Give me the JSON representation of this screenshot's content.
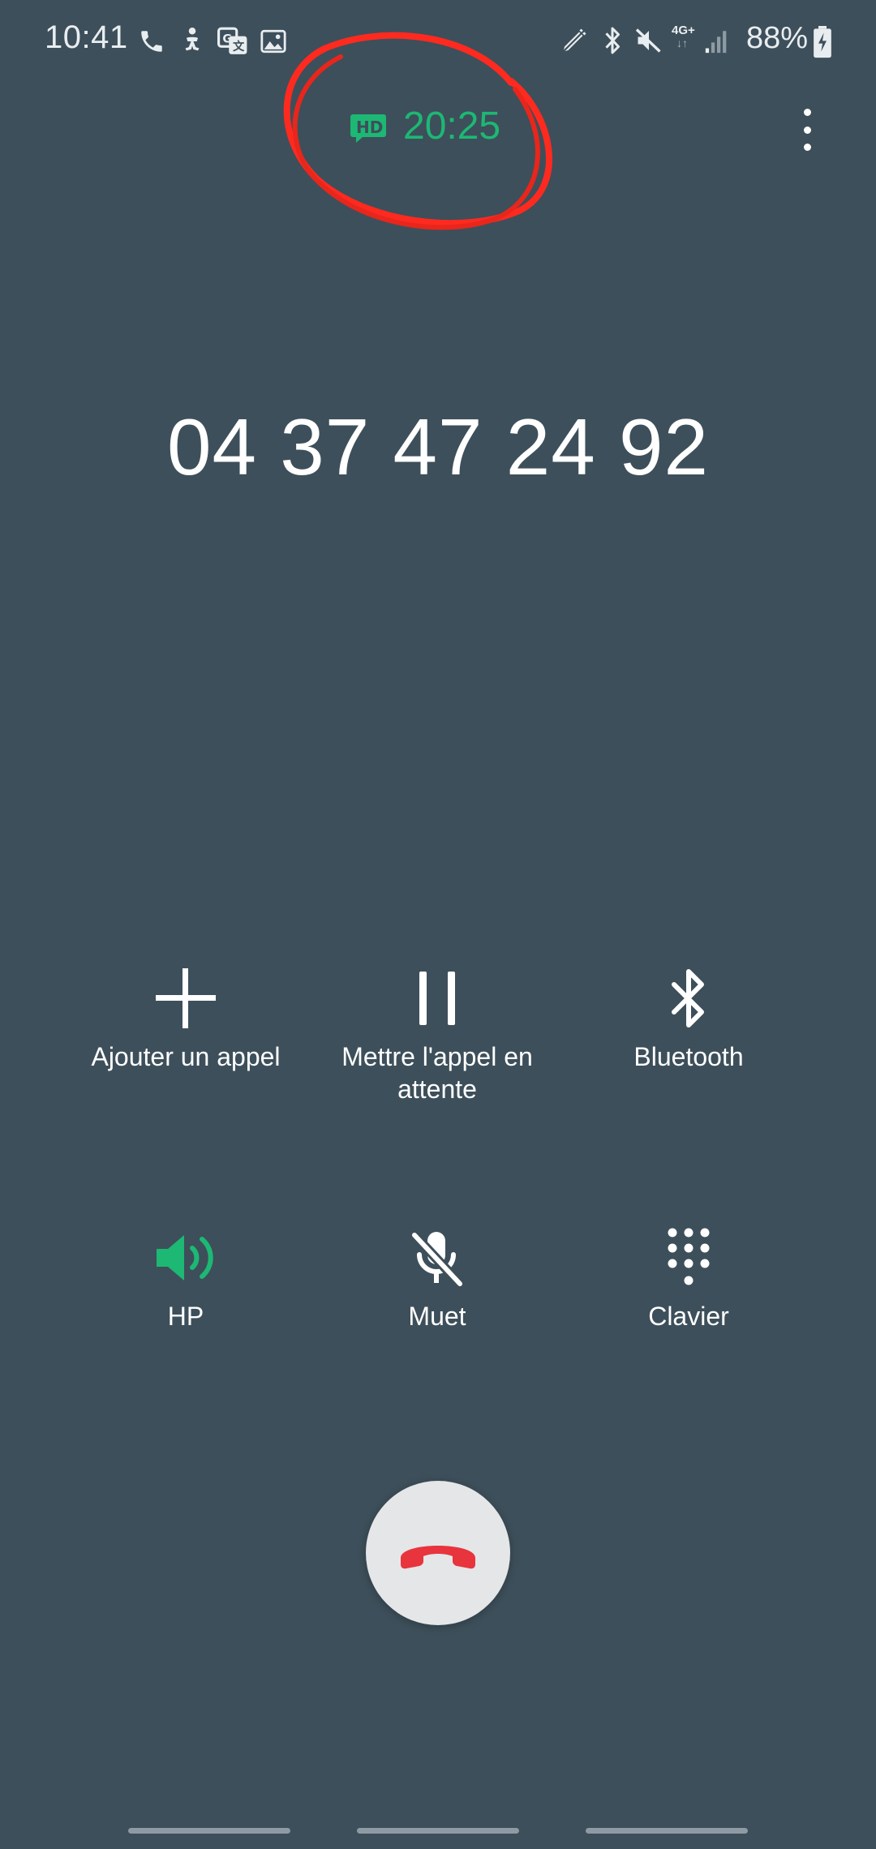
{
  "status_bar": {
    "time": "10:41",
    "left_icons": [
      "phone-icon",
      "accessibility-icon",
      "translate-icon",
      "image-icon"
    ],
    "right_icons": [
      "pencil-icon",
      "bluetooth-icon",
      "mute-icon",
      "network-4g-icon",
      "signal-icon",
      "battery-charging-icon"
    ],
    "network_label": "4G+",
    "battery": "88%"
  },
  "call": {
    "hd_badge": "HD",
    "timer": "20:25",
    "number": "04 37 47 24 92",
    "timer_color": "#1db874",
    "annotation_color": "#ff2a1f"
  },
  "controls": {
    "add_call": "Ajouter un appel",
    "hold": "Mettre l'appel en attente",
    "bluetooth": "Bluetooth",
    "speaker": "HP",
    "mute": "Muet",
    "keypad": "Clavier"
  },
  "colors": {
    "background": "#3d4f5a",
    "speaker_active": "#1db874",
    "end_call_icon": "#e8343d",
    "end_call_bg": "#e4e6e8"
  }
}
